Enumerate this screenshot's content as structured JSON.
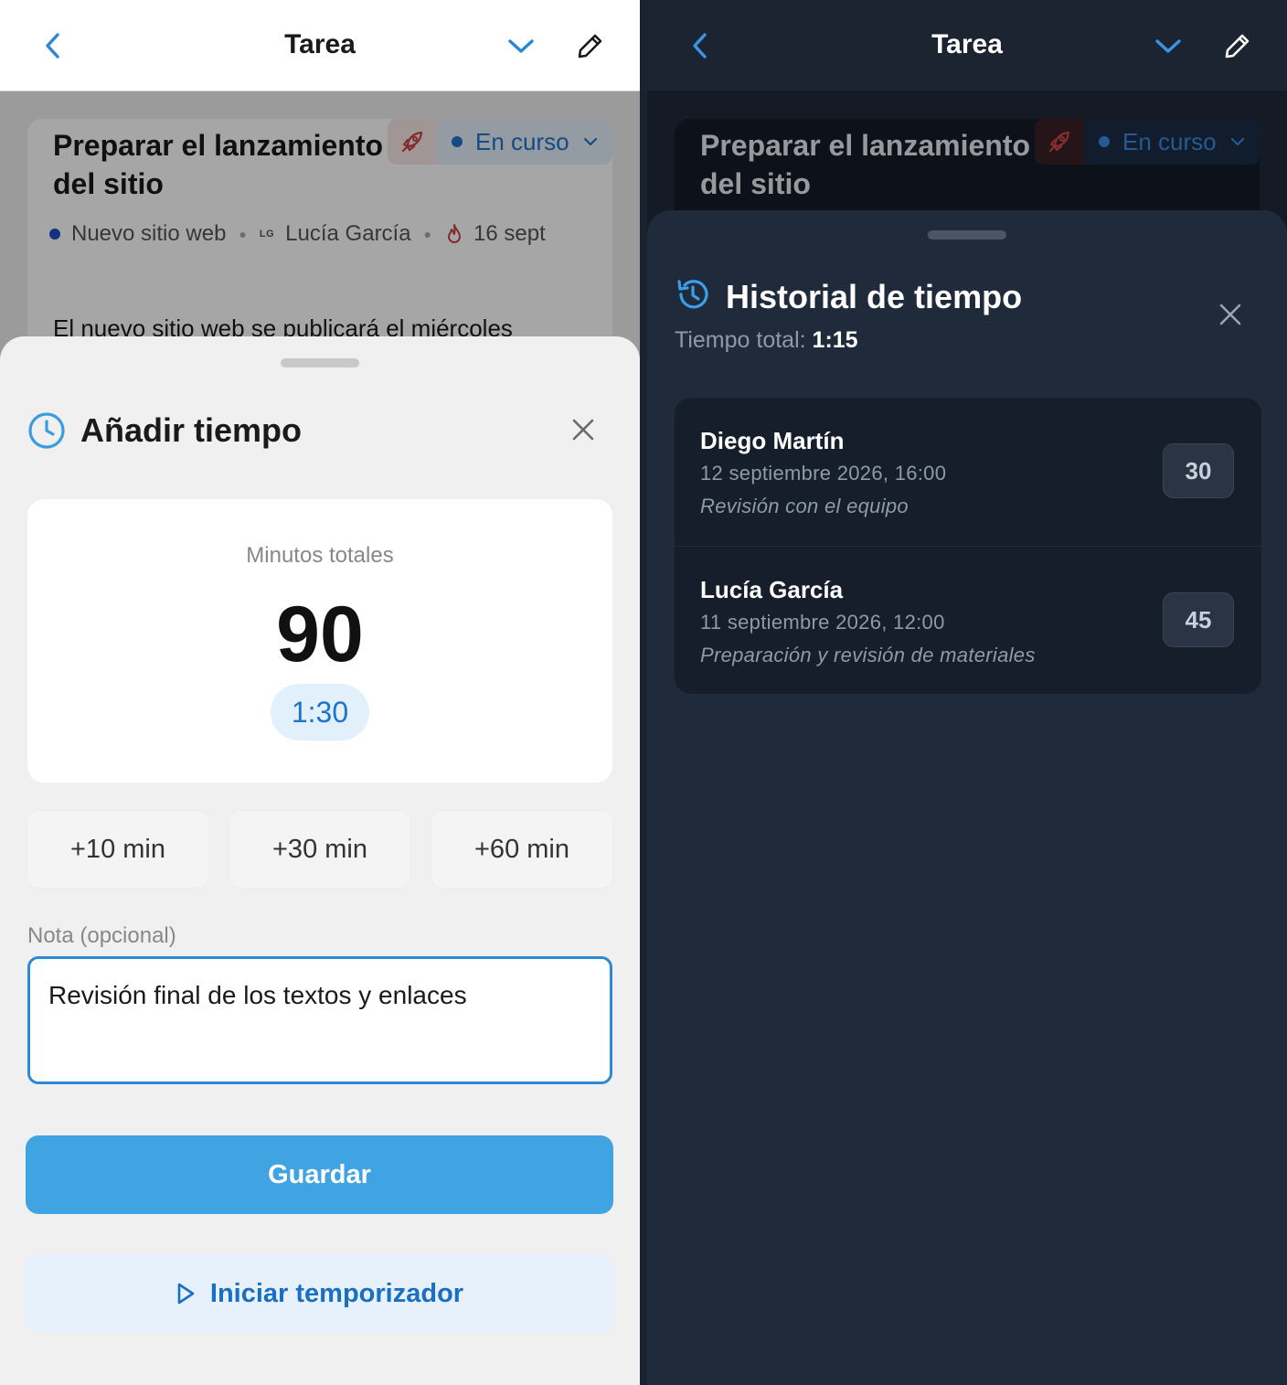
{
  "left": {
    "header": {
      "title": "Tarea"
    },
    "task": {
      "title": "Preparar el lanzamiento del sitio",
      "status": "En curso",
      "project": "Nuevo sitio web",
      "assignee_initials": "LG",
      "assignee": "Lucía García",
      "due": "16 sept",
      "description": "El nuevo sitio web se publicará el miércoles"
    },
    "sheet": {
      "title": "Añadir tiempo",
      "minutes_label": "Minutos totales",
      "minutes_value": "90",
      "minutes_hm": "1:30",
      "quick": [
        "+10 min",
        "+30 min",
        "+60 min"
      ],
      "note_label": "Nota (opcional)",
      "note_value": "Revisión final de los textos y enlaces",
      "save_label": "Guardar",
      "timer_label": "Iniciar temporizador"
    },
    "colors": {
      "accent": "#41a4e2",
      "link": "#1f73c9"
    }
  },
  "right": {
    "header": {
      "title": "Tarea"
    },
    "task": {
      "title": "Preparar el lanzamiento del sitio",
      "status": "En curso"
    },
    "sheet": {
      "title": "Historial de tiempo",
      "total_label": "Tiempo total:",
      "total_value": "1:15",
      "entries": [
        {
          "name": "Diego Martín",
          "date": "12 septiembre 2026, 16:00",
          "note": "Revisión con el equipo",
          "minutes": "30"
        },
        {
          "name": "Lucía García",
          "date": "11 septiembre 2026, 12:00",
          "note": "Preparación y revisión de materiales",
          "minutes": "45"
        }
      ]
    },
    "colors": {
      "background": "#1f2a3a",
      "card": "#161e2b"
    }
  }
}
